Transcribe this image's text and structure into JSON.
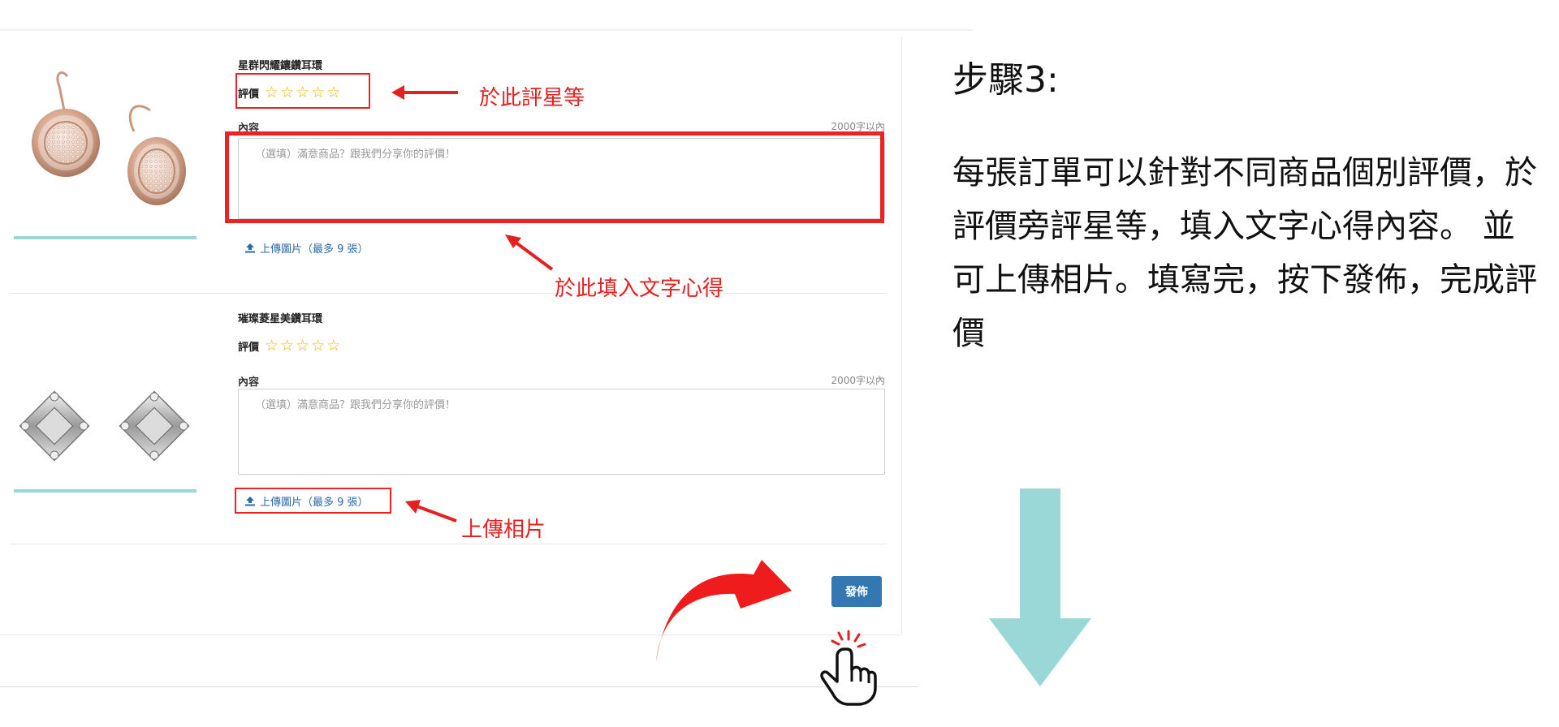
{
  "products": [
    {
      "name": "星群閃耀鑲鑽耳環",
      "rating_label": "評價",
      "stars": [
        "☆",
        "☆",
        "☆",
        "☆",
        "☆"
      ],
      "content_label": "內容",
      "limit": "2000字以內",
      "placeholder": "（選填）滿意商品？跟我們分享你的評價！",
      "upload": "上傳圖片（最多 9 張）"
    },
    {
      "name": "璀璨菱星美鑽耳環",
      "rating_label": "評價",
      "stars": [
        "☆",
        "☆",
        "☆",
        "☆",
        "☆"
      ],
      "content_label": "內容",
      "limit": "2000字以內",
      "placeholder": "（選填）滿意商品？跟我們分享你的評價！",
      "upload": "上傳圖片（最多 9 張）"
    }
  ],
  "annotations": {
    "rate": "於此評星等",
    "text": "於此填入文字心得",
    "photo": "上傳相片"
  },
  "publish_label": "發佈",
  "instructions": {
    "title": "步驟3:",
    "body": "每張訂單可以針對不同商品個別評價，於評價旁評星等，填入文字心得內容。 並可上傳相片。填寫完，按下發佈，完成評價"
  },
  "colors": {
    "highlight": "#ee2222",
    "accent_teal": "#9cd7d7",
    "button_blue": "#3478b3",
    "link_blue": "#2a6aa8",
    "star_gold": "#f0b400"
  },
  "icons": [
    "upload-icon",
    "gold-earring-image",
    "diamond-earring-image",
    "pointer-hand-icon",
    "curved-arrow-icon",
    "down-arrow-icon"
  ]
}
